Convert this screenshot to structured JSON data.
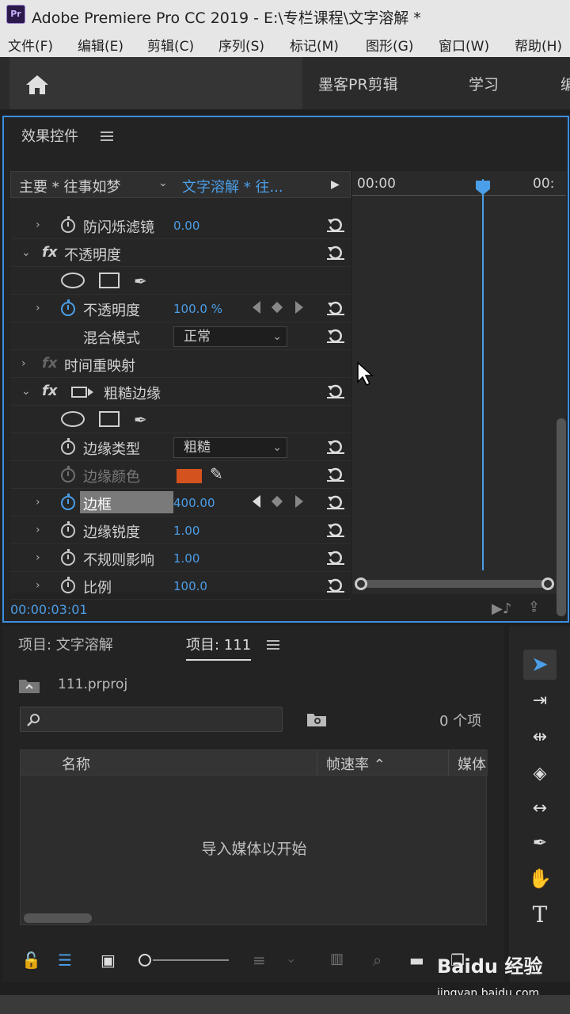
{
  "window": {
    "title": "Adobe Premiere Pro CC 2019 - E:\\专栏课程\\文字溶解 *",
    "app_icon": "Pr"
  },
  "menu": [
    "文件(F)",
    "编辑(E)",
    "剪辑(C)",
    "序列(S)",
    "标记(M)",
    "图形(G)",
    "窗口(W)",
    "帮助(H)"
  ],
  "workspace": {
    "tabs": [
      "墨客PR剪辑",
      "学习",
      "编"
    ]
  },
  "effect_controls": {
    "title": "效果控件",
    "master_clip": "主要 * 往事如梦",
    "sequence_clip": "文字溶解 * 往...",
    "timecode": "00:00:03:01",
    "ruler": [
      "00:00",
      "00:"
    ],
    "rows": {
      "anti_flicker": {
        "label": "防闪烁滤镜",
        "value": "0.00"
      },
      "opacity_group": {
        "label": "不透明度"
      },
      "opacity": {
        "label": "不透明度",
        "value": "100.0 %"
      },
      "blend": {
        "label": "混合模式",
        "value": "正常"
      },
      "time_remap": {
        "label": "时间重映射"
      },
      "rough_edges": {
        "label": "粗糙边缘"
      },
      "edge_type": {
        "label": "边缘类型",
        "value": "粗糙"
      },
      "edge_color": {
        "label": "边缘颜色",
        "swatch": "#d4521e"
      },
      "border": {
        "label": "边框",
        "value": "400.00"
      },
      "edge_sharpness": {
        "label": "边缘锐度",
        "value": "1.00"
      },
      "irregular": {
        "label": "不规则影响",
        "value": "1.00"
      },
      "scale": {
        "label": "比例",
        "value": "100.0"
      }
    }
  },
  "project": {
    "tab1": "项目: 文字溶解",
    "tab2": "项目: 111",
    "file": "111.prproj",
    "count": "0 个项",
    "columns": {
      "name": "名称",
      "fps": "帧速率",
      "media": "媒体"
    },
    "empty": "导入媒体以开始"
  },
  "watermark": {
    "brand": "Baidu 经验",
    "url": "jingyan.baidu.com"
  },
  "colors": {
    "accent": "#4b9ee8",
    "panel": "#232323",
    "edge_color": "#d4521e"
  }
}
